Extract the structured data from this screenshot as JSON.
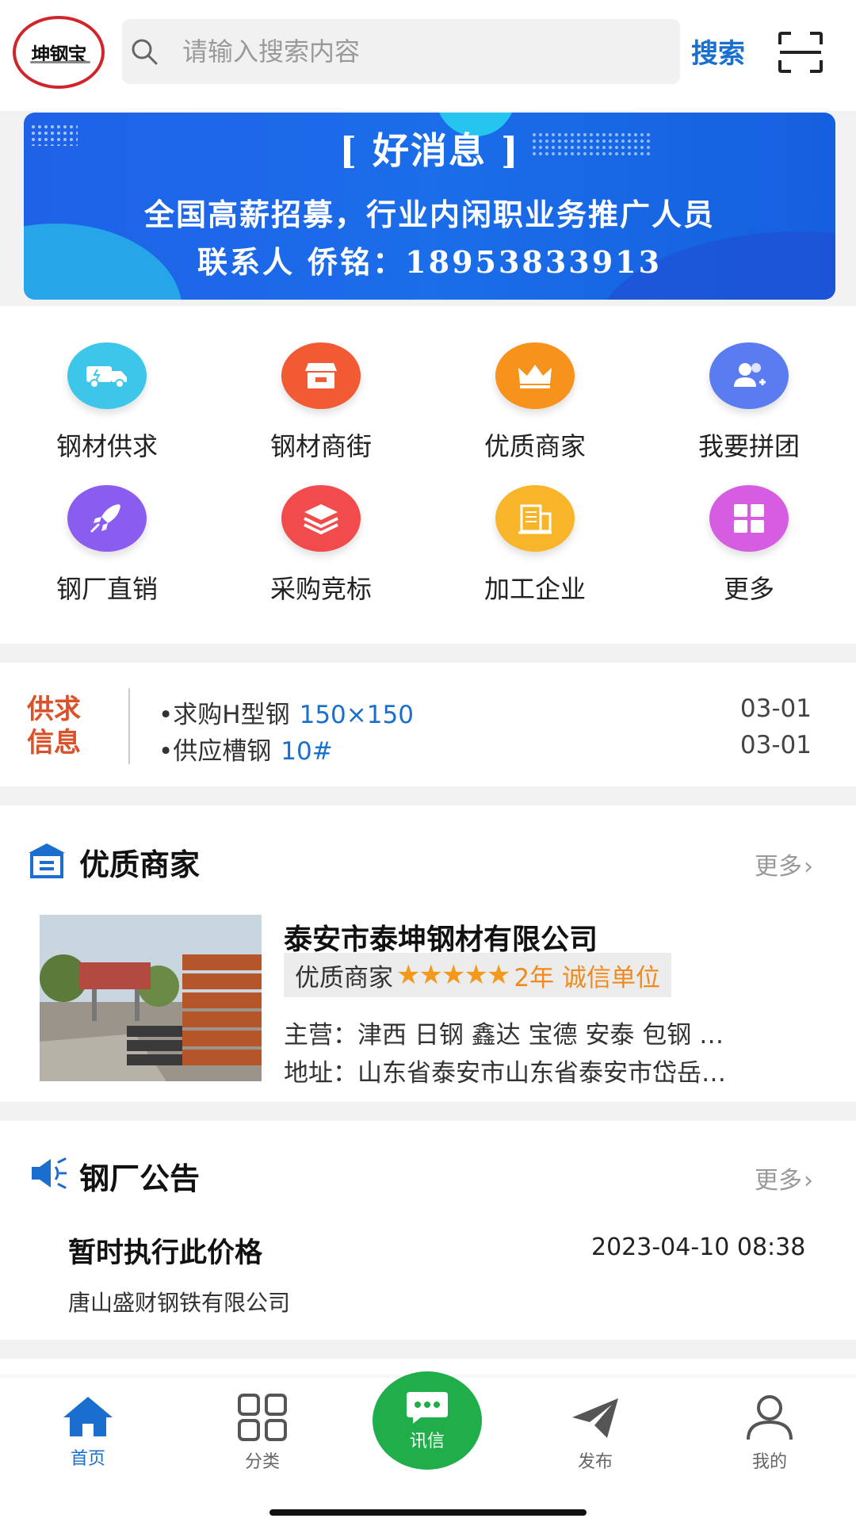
{
  "header": {
    "logo_text": "坤钢宝",
    "search_placeholder": "请输入搜索内容",
    "search_button": "搜索",
    "scan_icon": "scan-icon"
  },
  "banner": {
    "title": "[ 好消息 ]",
    "line1": "全国高薪招募，行业内闲职业务推广人员",
    "line2": "联系人 侨铭：18953833913"
  },
  "grid": {
    "items": [
      {
        "label": "钢材供求",
        "icon": "truck-icon",
        "color": "#3ec6ea"
      },
      {
        "label": "钢材商街",
        "icon": "shop-icon",
        "color": "#f25a34"
      },
      {
        "label": "优质商家",
        "icon": "crown-icon",
        "color": "#f7921c"
      },
      {
        "label": "我要拼团",
        "icon": "users-icon",
        "color": "#5b7cf0"
      },
      {
        "label": "钢厂直销",
        "icon": "rocket-icon",
        "color": "#8a5cf0"
      },
      {
        "label": "采购竞标",
        "icon": "layers-icon",
        "color": "#f24b4b"
      },
      {
        "label": "加工企业",
        "icon": "building-icon",
        "color": "#f9b52a"
      },
      {
        "label": "更多",
        "icon": "grid-more-icon",
        "color": "#d65de2"
      }
    ]
  },
  "supply": {
    "tag_line1": "供求",
    "tag_line2": "信息",
    "rows": [
      {
        "text": "•求购H型钢",
        "value": "150×150",
        "date": "03-01"
      },
      {
        "text": "•供应槽钢",
        "value": "10#",
        "date": "03-01"
      }
    ]
  },
  "merchants": {
    "title": "优质商家",
    "more": "更多",
    "item": {
      "name": "泰安市泰坤钢材有限公司",
      "badge": "优质商家",
      "stars": "★★★★★",
      "years": "2年 诚信单位",
      "main": "主营：津西 日钢 鑫达 宝德 安泰 包钢 …",
      "address": "地址：山东省泰安市山东省泰安市岱岳…"
    }
  },
  "notices": {
    "title": "钢厂公告",
    "more": "更多",
    "item": {
      "title": "暂时执行此价格",
      "time": "2023-04-10 08:38",
      "company": "唐山盛财钢铁有限公司"
    }
  },
  "bottom_nav": {
    "items": [
      {
        "label": "首页"
      },
      {
        "label": "分类"
      },
      {
        "label": "讯信"
      },
      {
        "label": "发布"
      },
      {
        "label": "我的"
      }
    ]
  },
  "colors": {
    "accent": "#1a6fce",
    "supply_tag": "#d9522a",
    "star": "#f39a1c",
    "chat_green": "#1fae4a"
  }
}
